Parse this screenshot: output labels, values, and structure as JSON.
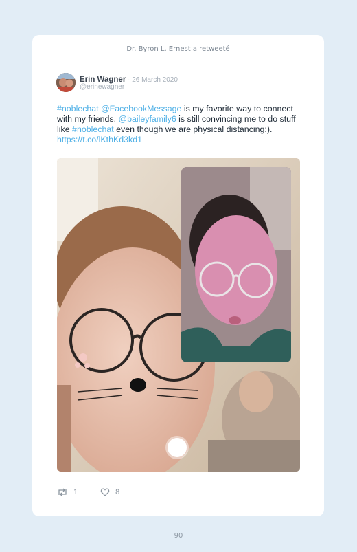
{
  "retweet_notice": "Dr. Byron L. Ernest a retweeté",
  "tweet": {
    "author_name": "Erin Wagner",
    "date": " · 26 March 2020",
    "handle": "@erinewagner",
    "text": {
      "hashtag_1": "#noblechat",
      "space_1": " ",
      "mention_1": "@FacebookMessage",
      "plain_1": " is my favorite way to connect with my friends. ",
      "mention_2": "@baileyfamily6",
      "plain_2": " is still convincing me to do stuff like ",
      "hashtag_2": "#noblechat",
      "plain_3": " even though we are physical distancing:). ",
      "link": "https://t.co/lKthKd3kd1"
    },
    "retweet_count": "1",
    "like_count": "8"
  },
  "icons": {
    "retweet": "retweet-icon",
    "like": "heart-icon",
    "shutter": "camera-shutter-button"
  },
  "colors": {
    "link": "#4fb0e6",
    "page_background": "#e2edf6",
    "card_background": "#ffffff"
  },
  "page_number": "90"
}
